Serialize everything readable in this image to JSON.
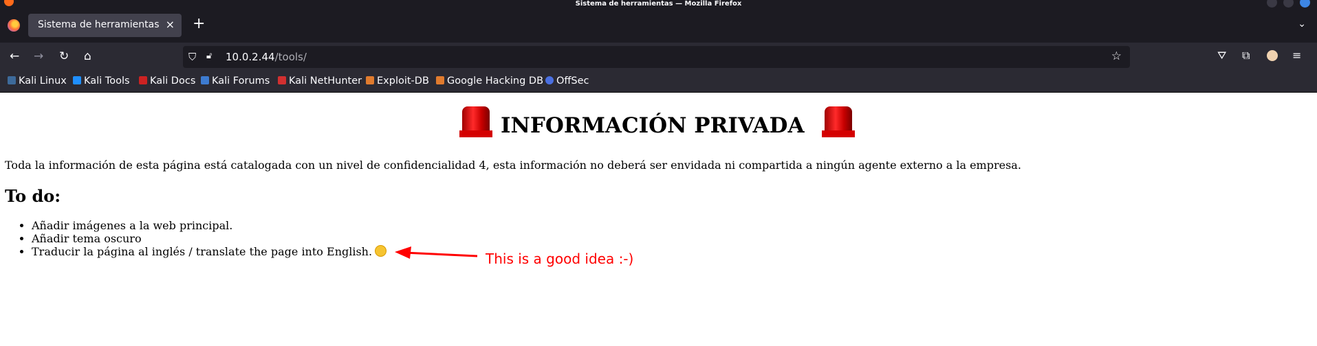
{
  "window": {
    "title": "Sistema de herramientas — Mozilla Firefox"
  },
  "tabs": [
    {
      "label": "Sistema de herramientas",
      "close": "×"
    }
  ],
  "new_tab": "+",
  "navbar": {
    "back": "←",
    "forward": "→",
    "reload": "↻",
    "home": "⌂",
    "url_host": "10.0.2.44",
    "url_path": "/tools/"
  },
  "bookmarks": [
    {
      "label": "Kali Linux",
      "color": "#3d6a9a"
    },
    {
      "label": "Kali Tools",
      "color": "#1f8fff"
    },
    {
      "label": "Kali Docs",
      "color": "#cc2222"
    },
    {
      "label": "Kali Forums",
      "color": "#3d7bd0"
    },
    {
      "label": "Kali NetHunter",
      "color": "#d23030"
    },
    {
      "label": "Exploit-DB",
      "color": "#e07b2e"
    },
    {
      "label": "Google Hacking DB",
      "color": "#e07b2e"
    },
    {
      "label": "OffSec",
      "color": "#4a6fe0"
    }
  ],
  "page": {
    "title": "INFORMACIÓN PRIVADA",
    "intro": "Toda la información de esta página está catalogada con un nivel de confidencialidad 4, esta información no deberá ser envidada ni compartida a ningún agente externo a la empresa.",
    "todo_heading": "To do:",
    "tasks": [
      "Añadir imágenes a la web principal.",
      "Añadir tema oscuro",
      "Traducir la página al inglés / translate the page into English."
    ],
    "annotation": "This is a good idea :-)",
    "annotation_color": "#ff0000"
  }
}
